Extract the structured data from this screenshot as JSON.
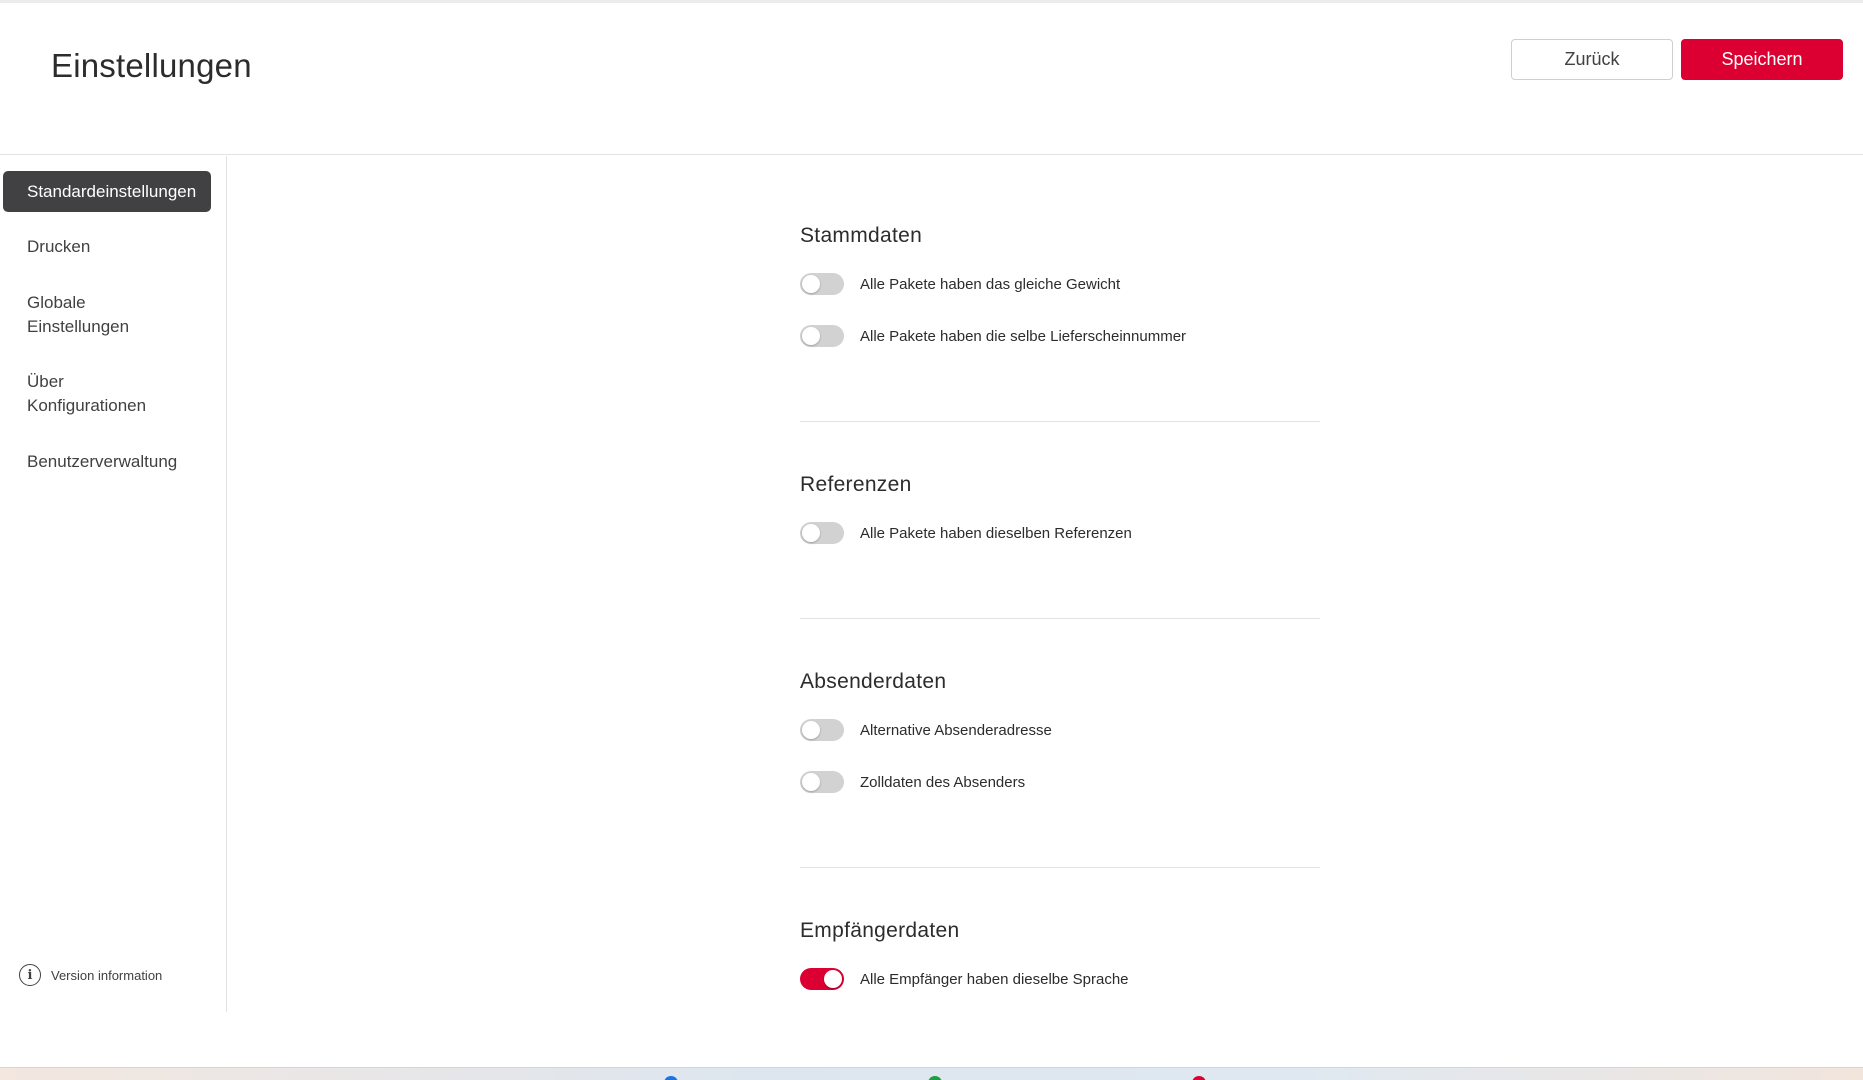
{
  "header": {
    "title": "Einstellungen",
    "back_label": "Zurück",
    "save_label": "Speichern"
  },
  "sidebar": {
    "items": [
      {
        "label": "Standardeinstellungen",
        "active": true
      },
      {
        "label": "Drucken",
        "active": false
      },
      {
        "label": "Globale Einstellungen",
        "active": false
      },
      {
        "label": "Über Konfigurationen",
        "active": false
      },
      {
        "label": "Benutzerverwaltung",
        "active": false
      }
    ],
    "version_label": "Version information",
    "version_icon": "info-icon"
  },
  "sections": [
    {
      "title": "Stammdaten",
      "toggles": [
        {
          "label": "Alle Pakete haben das gleiche Gewicht",
          "on": false
        },
        {
          "label": "Alle Pakete haben die selbe Lieferscheinnummer",
          "on": false
        }
      ]
    },
    {
      "title": "Referenzen",
      "toggles": [
        {
          "label": "Alle Pakete haben dieselben Referenzen",
          "on": false
        }
      ]
    },
    {
      "title": "Absenderdaten",
      "toggles": [
        {
          "label": "Alternative Absenderadresse",
          "on": false
        },
        {
          "label": "Zolldaten des Absenders",
          "on": false
        }
      ]
    },
    {
      "title": "Empfängerdaten",
      "toggles": [
        {
          "label": "Alle Empfänger haben dieselbe Sprache",
          "on": true
        }
      ]
    }
  ],
  "colors": {
    "accent": "#dc0032",
    "active_nav_bg": "#414042",
    "toggle_off": "#d2d2d2"
  }
}
